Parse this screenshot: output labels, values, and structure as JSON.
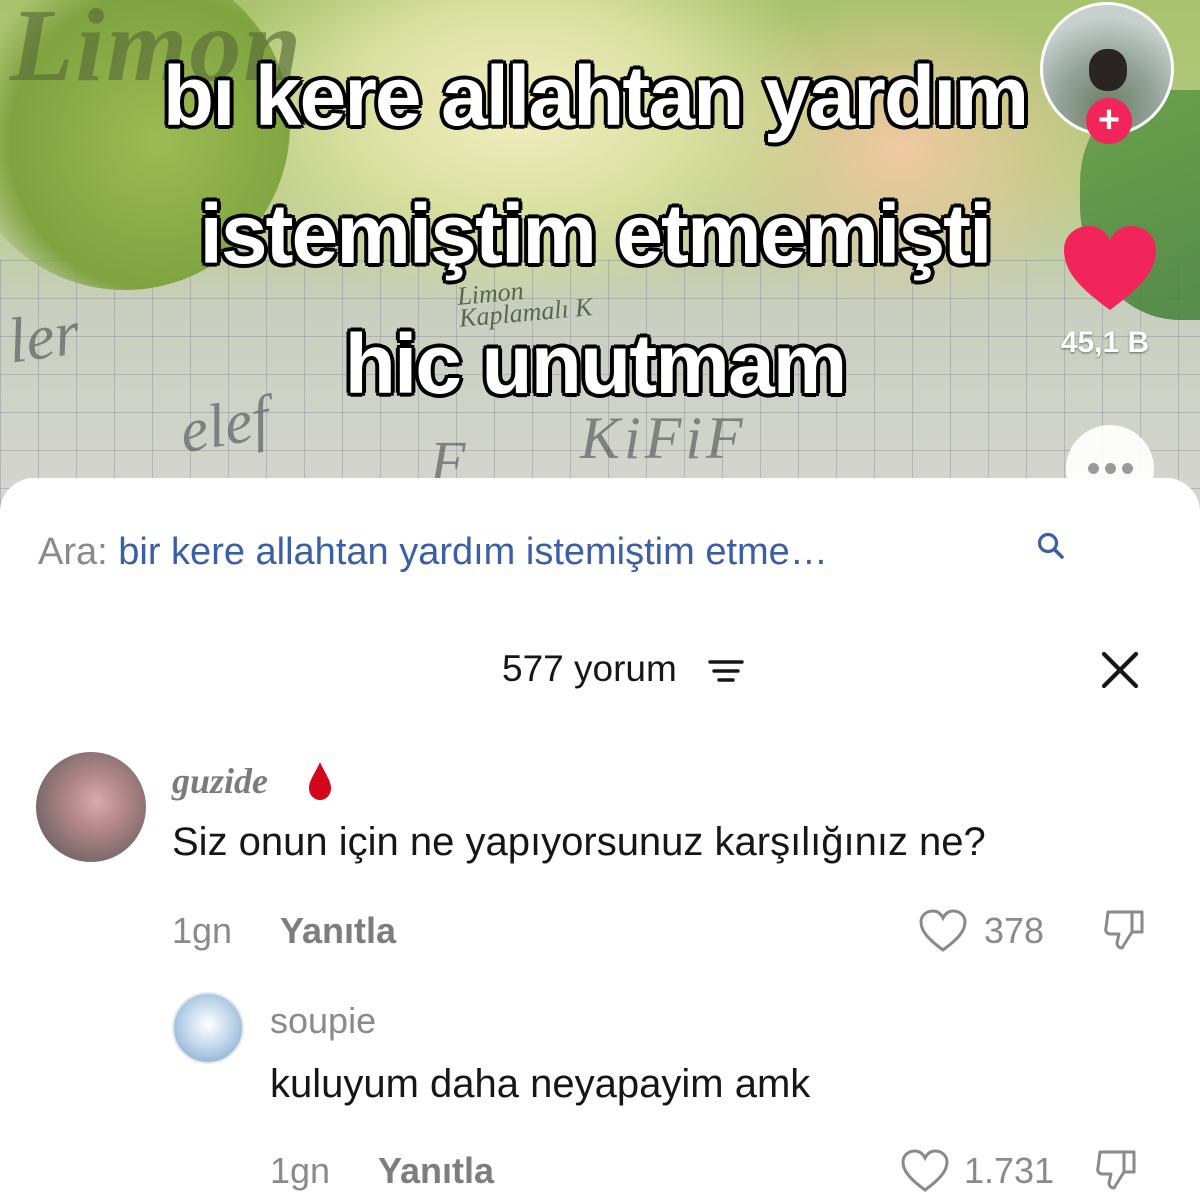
{
  "video": {
    "brand_text": "Limon",
    "pack_label_line1": "Limon",
    "pack_label_line2": "Kaplamalı K",
    "scribbles": [
      "ler",
      "elef",
      "F",
      "KiFiF"
    ],
    "overlay_lines": [
      "bı kere allahtan yardım",
      "istemiştim etmemişti",
      "hic unutmam"
    ],
    "like_count": "45,1 B",
    "icons": [
      "avatar",
      "follow-plus-icon",
      "heart-icon",
      "more-dots-icon"
    ]
  },
  "search": {
    "prefix": "Ara:",
    "query": "bir kere allahtan yardım istemiştim etme…",
    "icon": "search-icon"
  },
  "comments_header": {
    "count_label": "577 yorum",
    "filter_icon": "filter-icon",
    "close_icon": "close-icon"
  },
  "comments": [
    {
      "username": "guzide",
      "badge_icon": "blood-drop-icon",
      "text": "Siz onun için ne yapıyorsunuz karşılığınız ne?",
      "age": "1gn",
      "reply_label": "Yanıtla",
      "likes": "378"
    },
    {
      "username": "soupie",
      "text": "kuluyum daha neyapayim amk",
      "age": "1gn",
      "reply_label": "Yanıtla",
      "likes": "1.731"
    }
  ],
  "colors": {
    "accent": "#f2255b",
    "search_query": "#3a5fa8",
    "muted_text": "#8a8a8a",
    "badge_red": "#d3061c"
  }
}
